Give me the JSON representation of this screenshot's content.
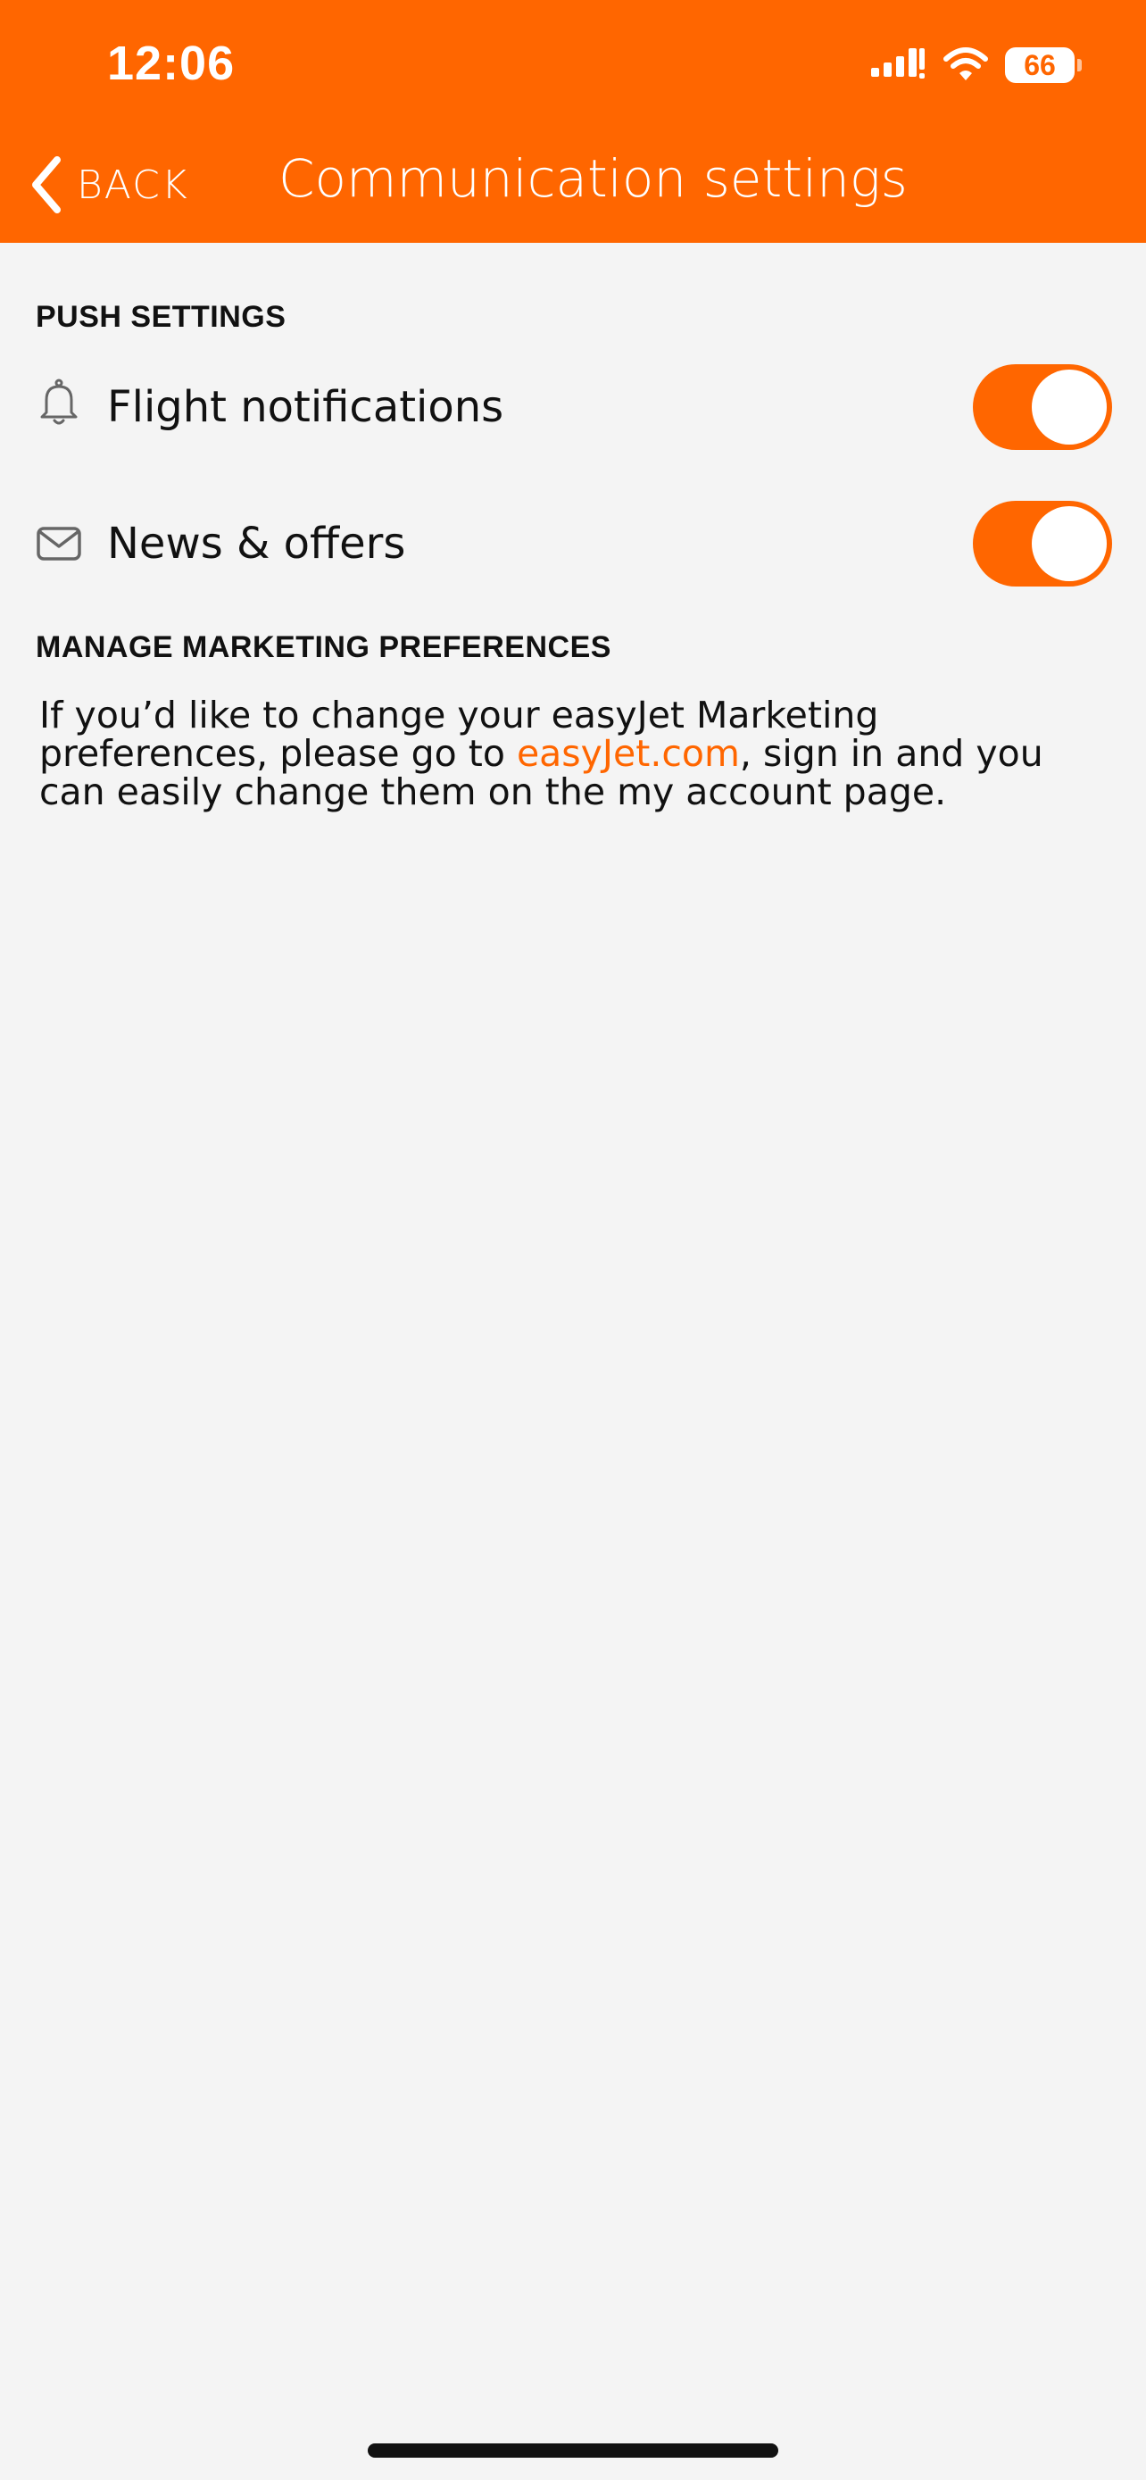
{
  "status_bar": {
    "time": "12:06",
    "battery_level": "66",
    "icons": [
      "cellular-signal-icon",
      "wifi-icon",
      "battery-icon"
    ]
  },
  "nav": {
    "back_label": "BACK",
    "title": "Communication settings"
  },
  "push_settings": {
    "heading": "PUSH SETTINGS",
    "items": [
      {
        "label": "Flight notifications",
        "icon": "bell-icon",
        "enabled": true
      },
      {
        "label": "News & offers",
        "icon": "envelope-icon",
        "enabled": true
      }
    ]
  },
  "marketing": {
    "heading": "MANAGE MARKETING PREFERENCES",
    "text_before": "If you’d like to change your easyJet Marketing preferences, please go to ",
    "link_text": "easyJet.com",
    "text_after": ", sign in and you can easily change them on the my account page."
  },
  "colors": {
    "brand": "#ff6600",
    "background": "#f4f4f4",
    "text": "#111111",
    "toggle_on": "#ff6600"
  }
}
